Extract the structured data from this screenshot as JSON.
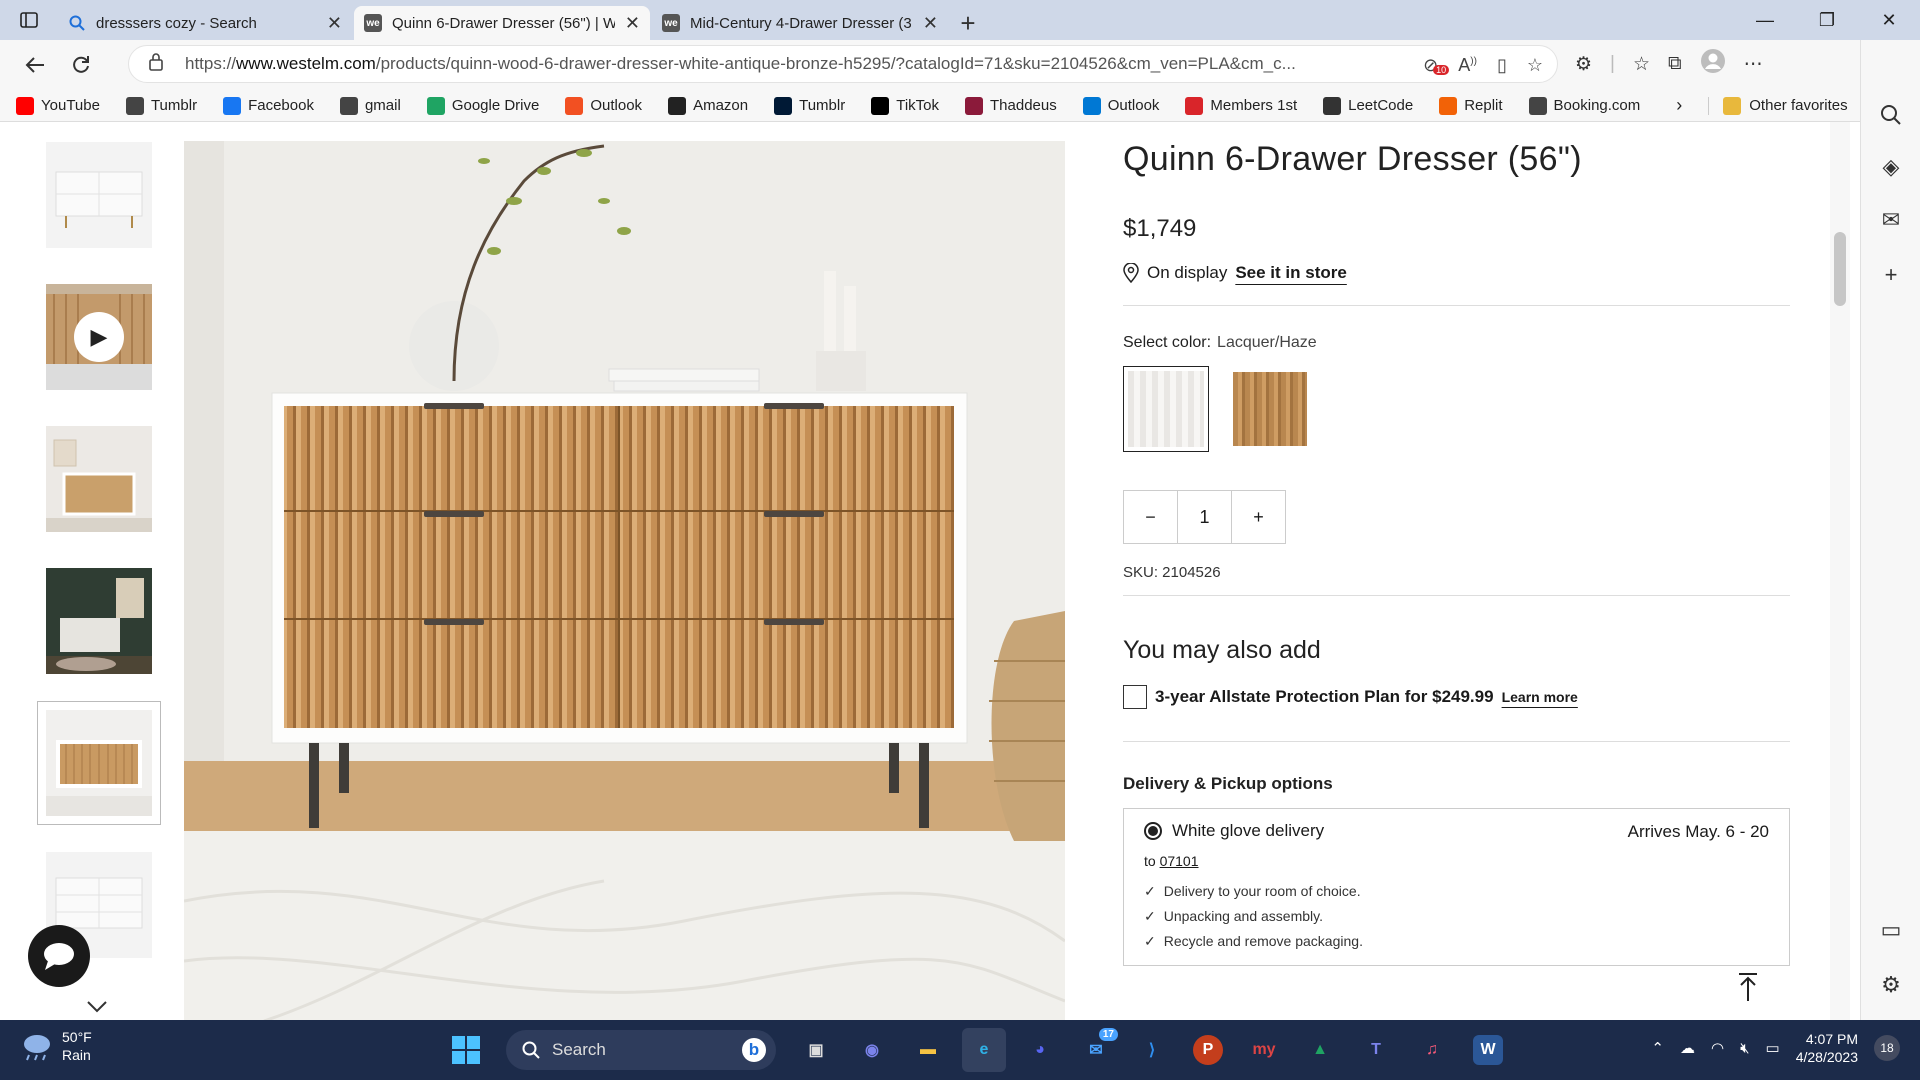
{
  "tabs": [
    {
      "label": "dresssers cozy - Search"
    },
    {
      "label": "Quinn 6-Drawer Dresser (56\") | W"
    },
    {
      "label": "Mid-Century 4-Drawer Dresser (3"
    }
  ],
  "address": {
    "prefix": "https://",
    "domain": "www.westelm.com",
    "path": "/products/quinn-wood-6-drawer-dresser-white-antique-bronze-h5295/?catalogId=71&sku=2104526&cm_ven=PLA&cm_c..."
  },
  "ext_badge": "10",
  "favorites": [
    {
      "label": "YouTube",
      "color": "#ff0000",
      "icon": "youtube-icon"
    },
    {
      "label": "Tumblr",
      "color": "#444",
      "icon": "doc-icon"
    },
    {
      "label": "Facebook",
      "color": "#1877f2",
      "icon": "facebook-icon"
    },
    {
      "label": "gmail",
      "color": "#444",
      "icon": "doc-icon"
    },
    {
      "label": "Google Drive",
      "color": "#1fa463",
      "icon": "drive-icon"
    },
    {
      "label": "Outlook",
      "color": "#f25022",
      "icon": "windows-icon"
    },
    {
      "label": "Amazon",
      "color": "#222",
      "icon": "amazon-icon"
    },
    {
      "label": "Tumblr",
      "color": "#001935",
      "icon": "tumblr-icon"
    },
    {
      "label": "TikTok",
      "color": "#000",
      "icon": "tiktok-icon"
    },
    {
      "label": "Thaddeus",
      "color": "#8b1a3a",
      "icon": "my-icon"
    },
    {
      "label": "Outlook",
      "color": "#0078d4",
      "icon": "outlook-icon"
    },
    {
      "label": "Members 1st",
      "color": "#d9252a",
      "icon": "m-icon"
    },
    {
      "label": "LeetCode",
      "color": "#333",
      "icon": "leetcode-icon"
    },
    {
      "label": "Replit",
      "color": "#f26207",
      "icon": "replit-icon"
    },
    {
      "label": "Booking.com",
      "color": "#444",
      "icon": "doc-icon"
    }
  ],
  "other_favorites": "Other favorites",
  "product": {
    "title": "Quinn 6-Drawer Dresser (56\")",
    "price": "$1,749",
    "on_display": "On display",
    "see_in_store": "See it in store",
    "select_color_label": "Select color:",
    "selected_color": "Lacquer/Haze",
    "quantity": "1",
    "sku": "SKU: 2104526"
  },
  "addons": {
    "heading": "You may also add",
    "protection": "3-year Allstate Protection Plan for $249.99",
    "learn_more": "Learn more"
  },
  "delivery": {
    "heading": "Delivery & Pickup options",
    "option": "White glove delivery",
    "arrives": "Arrives May. 6 - 20",
    "to_label": "to",
    "zip": "07101",
    "bullets": [
      "Delivery to your room of choice.",
      "Unpacking and assembly.",
      "Recycle and remove packaging."
    ]
  },
  "taskbar": {
    "temp": "50°F",
    "condition": "Rain",
    "search": "Search",
    "time": "4:07 PM",
    "date": "4/28/2023",
    "notifications": "18",
    "mail_badge": "17"
  },
  "colors": {
    "tabbar": "#cfd8e8",
    "taskbar": "#1c2b4a",
    "accent": "#1e6fd9"
  }
}
